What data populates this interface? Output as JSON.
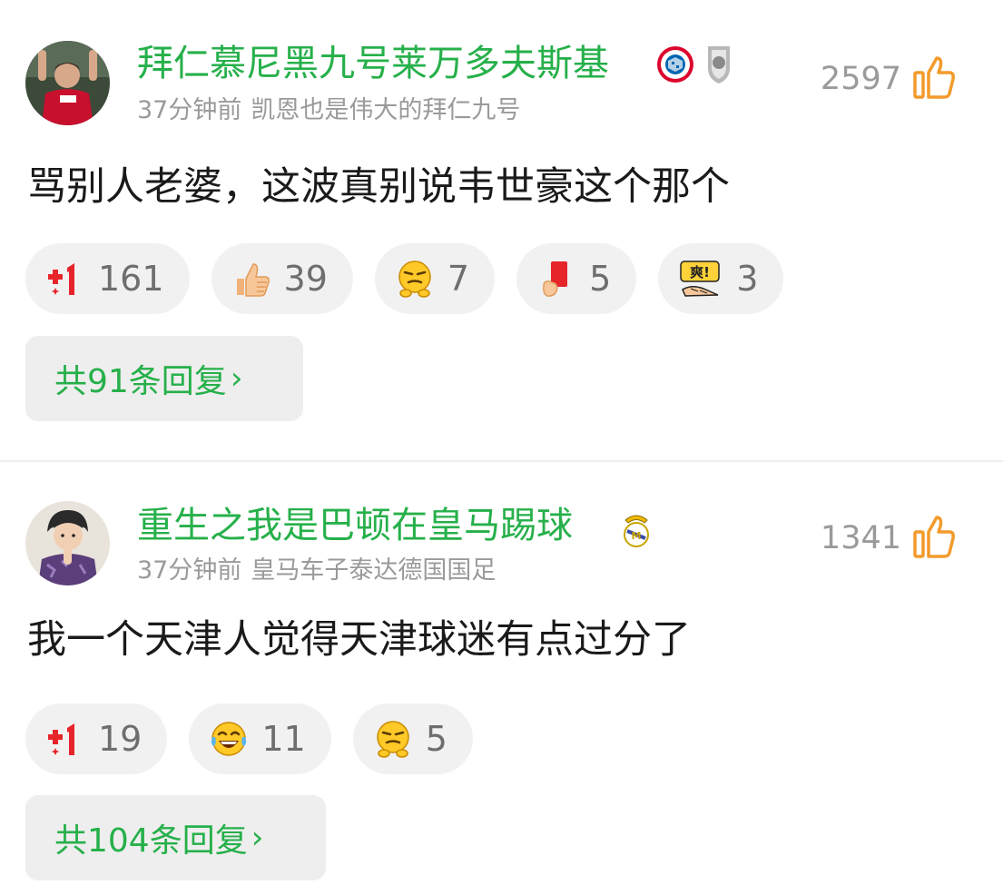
{
  "comments": [
    {
      "username": "拜仁慕尼黑九号莱万多夫斯基",
      "time": "37分钟前",
      "signature": "凯恩也是伟大的拜仁九号",
      "like_count": "2597",
      "text": "骂别人老婆，这波真别说韦世豪这个那个",
      "badges": [
        "fc-bayern-badge",
        "bundesliga-shield-badge"
      ],
      "reactions": [
        {
          "icon": "plus-one-icon",
          "count": "161"
        },
        {
          "icon": "thumbs-up-emoji",
          "count": "39"
        },
        {
          "icon": "smirk-emoji",
          "count": "7"
        },
        {
          "icon": "red-card-emoji",
          "count": "5"
        },
        {
          "icon": "shuang-emoji",
          "count": "3"
        }
      ],
      "replies_label": "共91条回复"
    },
    {
      "username": "重生之我是巴顿在皇马踢球",
      "time": "37分钟前",
      "signature": "皇马车子泰达德国国足",
      "like_count": "1341",
      "text": "我一个天津人觉得天津球迷有点过分了",
      "badges": [
        "real-madrid-badge"
      ],
      "reactions": [
        {
          "icon": "plus-one-icon",
          "count": "19"
        },
        {
          "icon": "laughing-tears-emoji",
          "count": "11"
        },
        {
          "icon": "smirk-emoji",
          "count": "5"
        }
      ],
      "replies_label": "共104条回复"
    }
  ],
  "colors": {
    "accent": "#26b04a",
    "like_orange": "#f39a2b",
    "pill_bg": "#f1f1f1",
    "meta_gray": "#9a9a9a"
  },
  "reaction_glyphs": {
    "shuang_text": "爽!"
  },
  "chevron": "›"
}
